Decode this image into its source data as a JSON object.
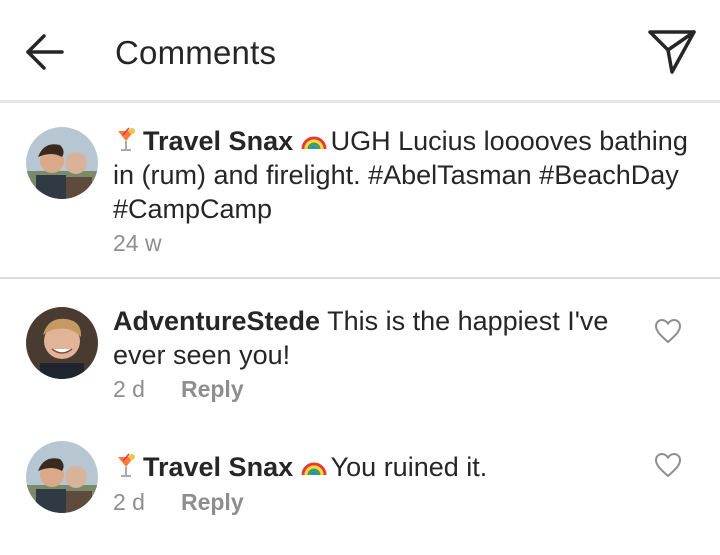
{
  "header": {
    "title": "Comments",
    "back_icon": "arrow-left-icon",
    "send_icon": "paper-plane-icon"
  },
  "caption": {
    "user_prefix_icon": "tropical-drink-emoji",
    "user": "Travel Snax",
    "user_suffix_icon": "rainbow-emoji",
    "text_line1": "UGH Lucius looooves bathing",
    "text_line2": "in (rum) and firelight. #AbelTasman #BeachDay",
    "text_line3": "#CampCamp",
    "time": "24 w"
  },
  "comments": [
    {
      "user": "AdventureStede",
      "text_line1": "This is the happiest I've",
      "text_line2": "ever seen you!",
      "time": "2 d",
      "reply_label": "Reply"
    },
    {
      "user_prefix_icon": "tropical-drink-emoji",
      "user": "Travel Snax",
      "user_suffix_icon": "rainbow-emoji",
      "text_line1": "You ruined it.",
      "time": "2 d",
      "reply_label": "Reply"
    }
  ],
  "colors": {
    "text": "#262626",
    "secondary": "#8e8e8e",
    "divider": "#dbdbdb"
  }
}
